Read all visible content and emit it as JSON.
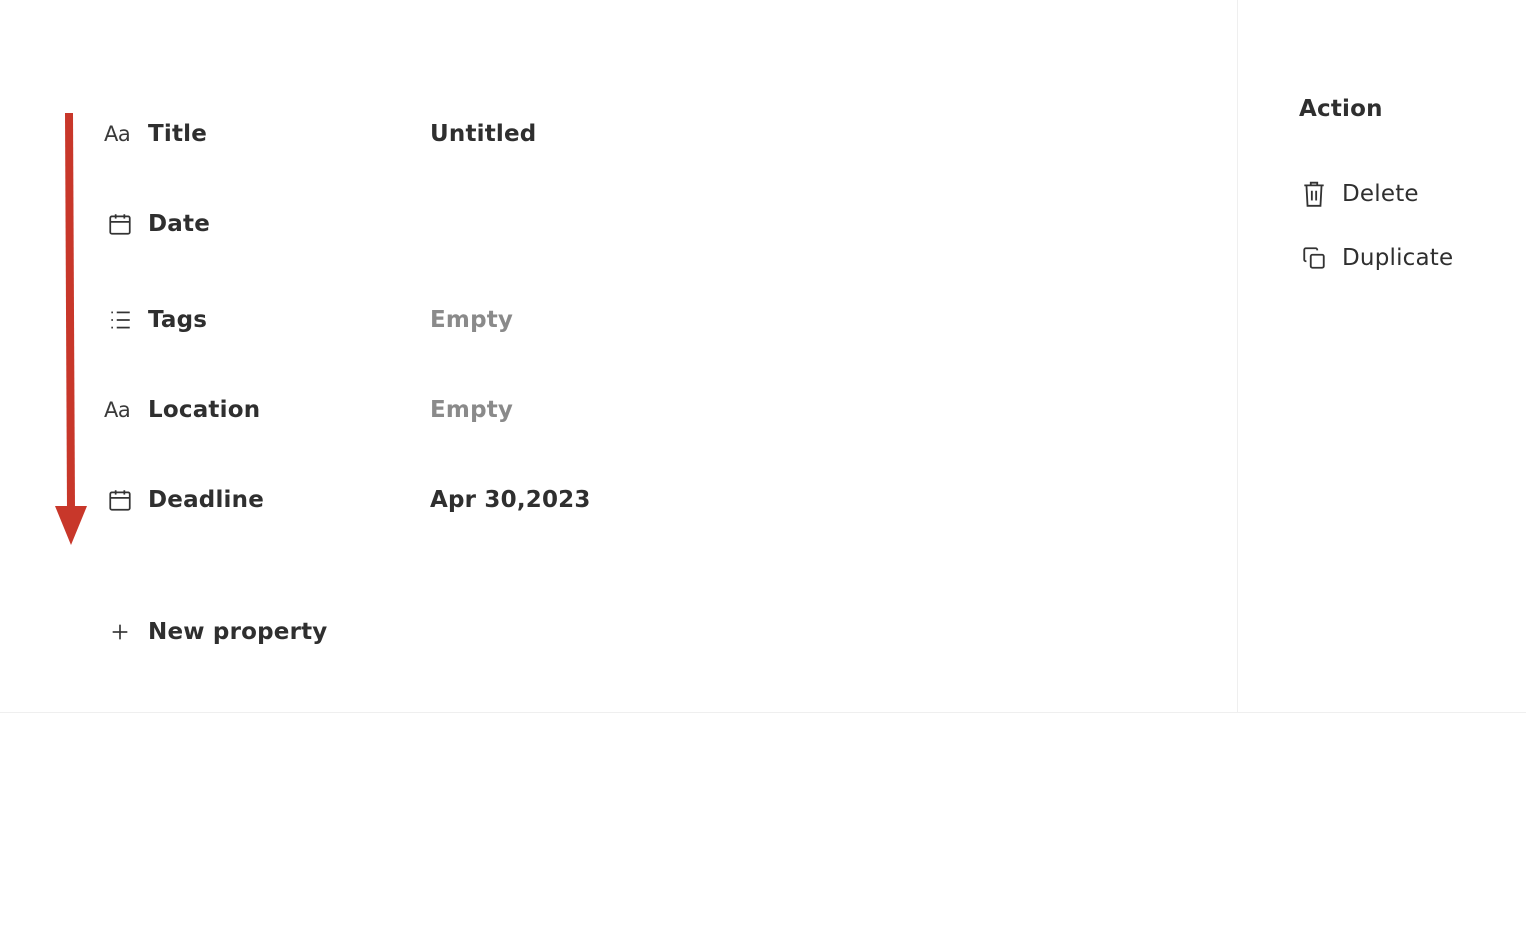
{
  "properties": [
    {
      "icon": "text-type-icon",
      "icon_text": "Aa",
      "name": "Title",
      "value": "Untitled",
      "empty": false
    },
    {
      "icon": "calendar-icon",
      "name": "Date",
      "value": "",
      "empty": false
    },
    {
      "icon": "list-icon",
      "name": "Tags",
      "value": "Empty",
      "empty": true
    },
    {
      "icon": "text-type-icon",
      "icon_text": "Aa",
      "name": "Location",
      "value": "Empty",
      "empty": true
    },
    {
      "icon": "calendar-icon",
      "name": "Deadline",
      "value": "Apr 30,2023",
      "empty": false
    }
  ],
  "new_property": {
    "icon": "plus-icon",
    "label": "New property"
  },
  "actions": {
    "title": "Action",
    "items": [
      {
        "icon": "trash-icon",
        "label": "Delete"
      },
      {
        "icon": "duplicate-icon",
        "label": "Duplicate"
      }
    ]
  },
  "colors": {
    "arrow": "#c8372a",
    "text": "#2f2f2f",
    "muted": "#8a8a8a",
    "border": "#efefef"
  }
}
